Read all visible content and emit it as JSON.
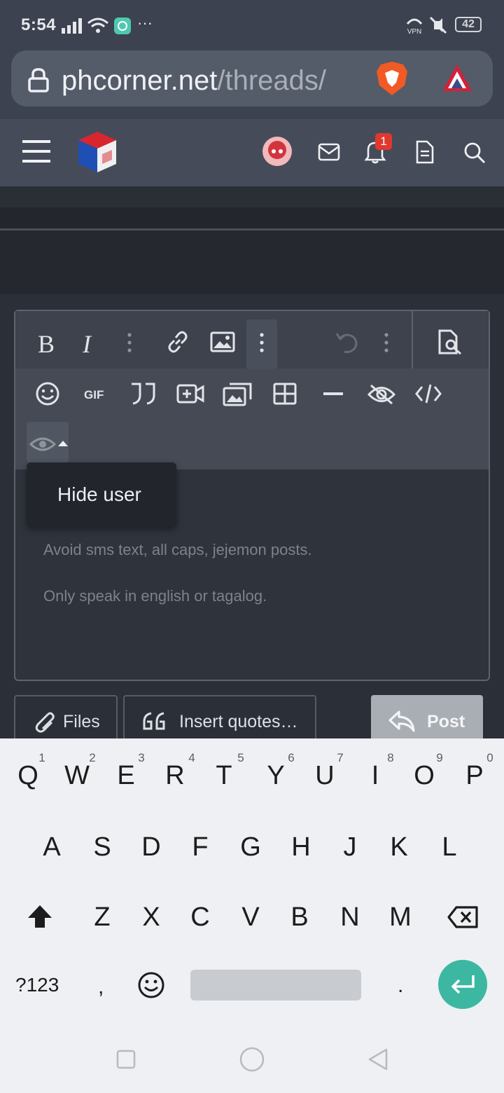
{
  "status_bar": {
    "time": "5:54",
    "battery": "42"
  },
  "browser": {
    "url_host": "phcorner.net",
    "url_path": "/threads/"
  },
  "header": {
    "notification_count": "1"
  },
  "toolbar": {
    "bold_label": "B",
    "italic_label": "I",
    "gif_label": "GIF"
  },
  "dropdown": {
    "hide_user": "Hide user"
  },
  "editor": {
    "rule1": "Avoid sms text, all caps, jejemon posts.",
    "rule2": "Only speak in english or tagalog."
  },
  "buttons": {
    "files": "Files",
    "insert_quotes": "Insert quotes…",
    "post": "Post"
  },
  "keyboard": {
    "row1": [
      "Q",
      "W",
      "E",
      "R",
      "T",
      "Y",
      "U",
      "I",
      "O",
      "P"
    ],
    "row1_numbers": [
      "1",
      "2",
      "3",
      "4",
      "5",
      "6",
      "7",
      "8",
      "9",
      "0"
    ],
    "row2": [
      "A",
      "S",
      "D",
      "F",
      "G",
      "H",
      "J",
      "K",
      "L"
    ],
    "row3": [
      "Z",
      "X",
      "C",
      "V",
      "B",
      "N",
      "M"
    ],
    "symbols_key": "?123",
    "comma": ",",
    "period": "."
  }
}
